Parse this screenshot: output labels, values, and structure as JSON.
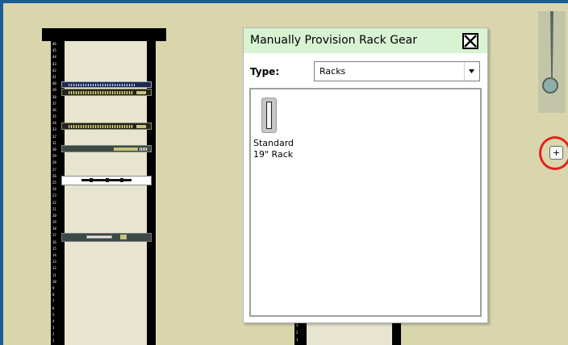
{
  "dialog": {
    "title": "Manually Provision Rack Gear",
    "close_icon": "close-box-icon",
    "type_label": "Type:",
    "type_value": "Racks",
    "dropdown_icon": "triangle-down-icon",
    "items": [
      {
        "label": "Standard\n19\" Rack",
        "icon": "rack-icon"
      }
    ]
  },
  "rack": {
    "unit_numbers": [
      "46",
      "45",
      "44",
      "43",
      "42",
      "41",
      "40",
      "39",
      "38",
      "37",
      "36",
      "35",
      "34",
      "33",
      "32",
      "31",
      "30",
      "29",
      "28",
      "27",
      "26",
      "25",
      "24",
      "23",
      "22",
      "21",
      "20",
      "19",
      "18",
      "17",
      "16",
      "15",
      "14",
      "13",
      "12",
      "11",
      "10",
      "9",
      "8",
      "7",
      "6",
      "5",
      "4",
      "3",
      "2",
      "1"
    ],
    "rack2_unit_numbers": [
      "3",
      "2",
      "1"
    ]
  },
  "controls": {
    "zoom_in_label": "+",
    "slider_icon": "zoom-slider-icon"
  },
  "colors": {
    "frame_border": "#1a5c96",
    "background": "#d9d6ae",
    "dialog_header": "#d8f3d2",
    "highlight": "#e2231a"
  }
}
